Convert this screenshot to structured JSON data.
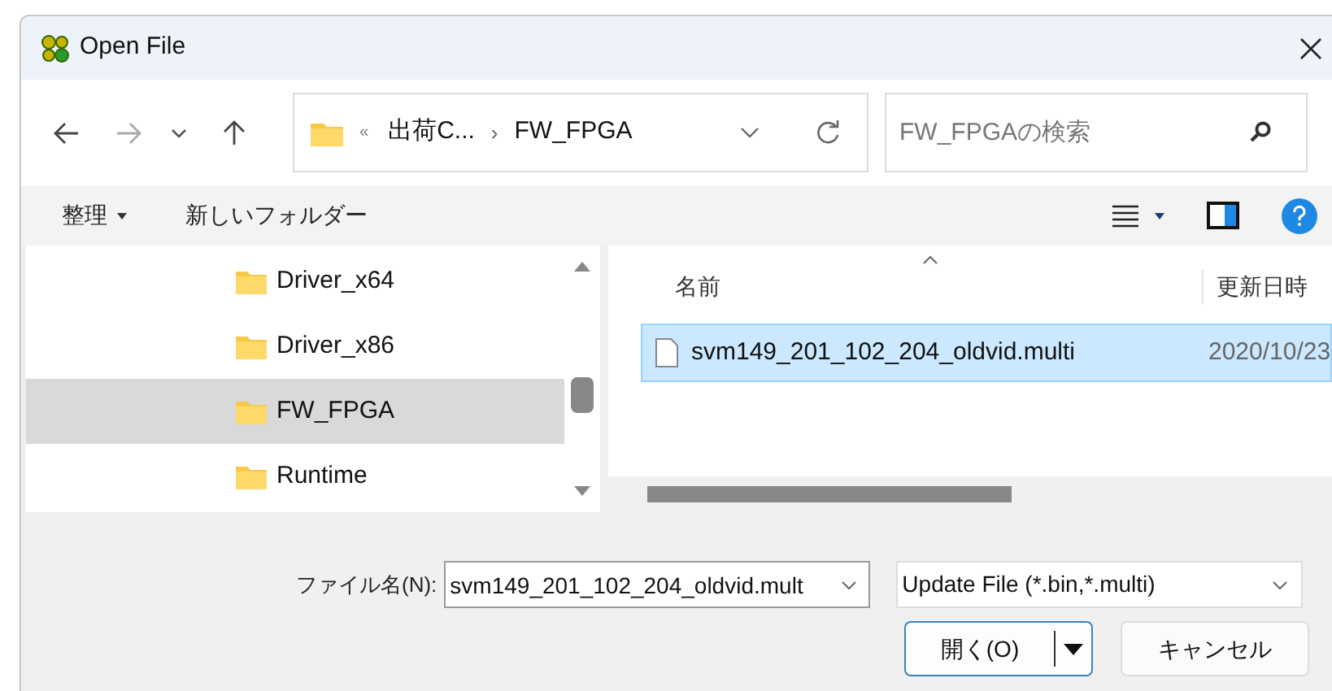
{
  "window": {
    "title": "Open File"
  },
  "nav": {
    "breadcrumb_prefix": "«",
    "path": [
      {
        "label": "出荷C..."
      },
      {
        "label": "FW_FPGA"
      }
    ],
    "separator": "›"
  },
  "search": {
    "placeholder": "FW_FPGAの検索"
  },
  "toolbar": {
    "organize": "整理",
    "new_folder": "新しいフォルダー"
  },
  "sidebar": {
    "items": [
      {
        "label": "Driver_x64",
        "selected": false
      },
      {
        "label": "Driver_x86",
        "selected": false
      },
      {
        "label": "FW_FPGA",
        "selected": true
      },
      {
        "label": "Runtime",
        "selected": false
      }
    ]
  },
  "file_list": {
    "columns": [
      {
        "label": "名前"
      },
      {
        "label": "更新日時"
      }
    ],
    "rows": [
      {
        "name": "svm149_201_102_204_oldvid.multi",
        "date": "2020/10/23",
        "selected": true
      }
    ]
  },
  "footer": {
    "filename_label": "ファイル名(N):",
    "filename_value": "svm149_201_102_204_oldvid.mult",
    "filter": "Update File (*.bin,*.multi)",
    "open_button": "開く(O)",
    "cancel_button": "キャンセル"
  }
}
